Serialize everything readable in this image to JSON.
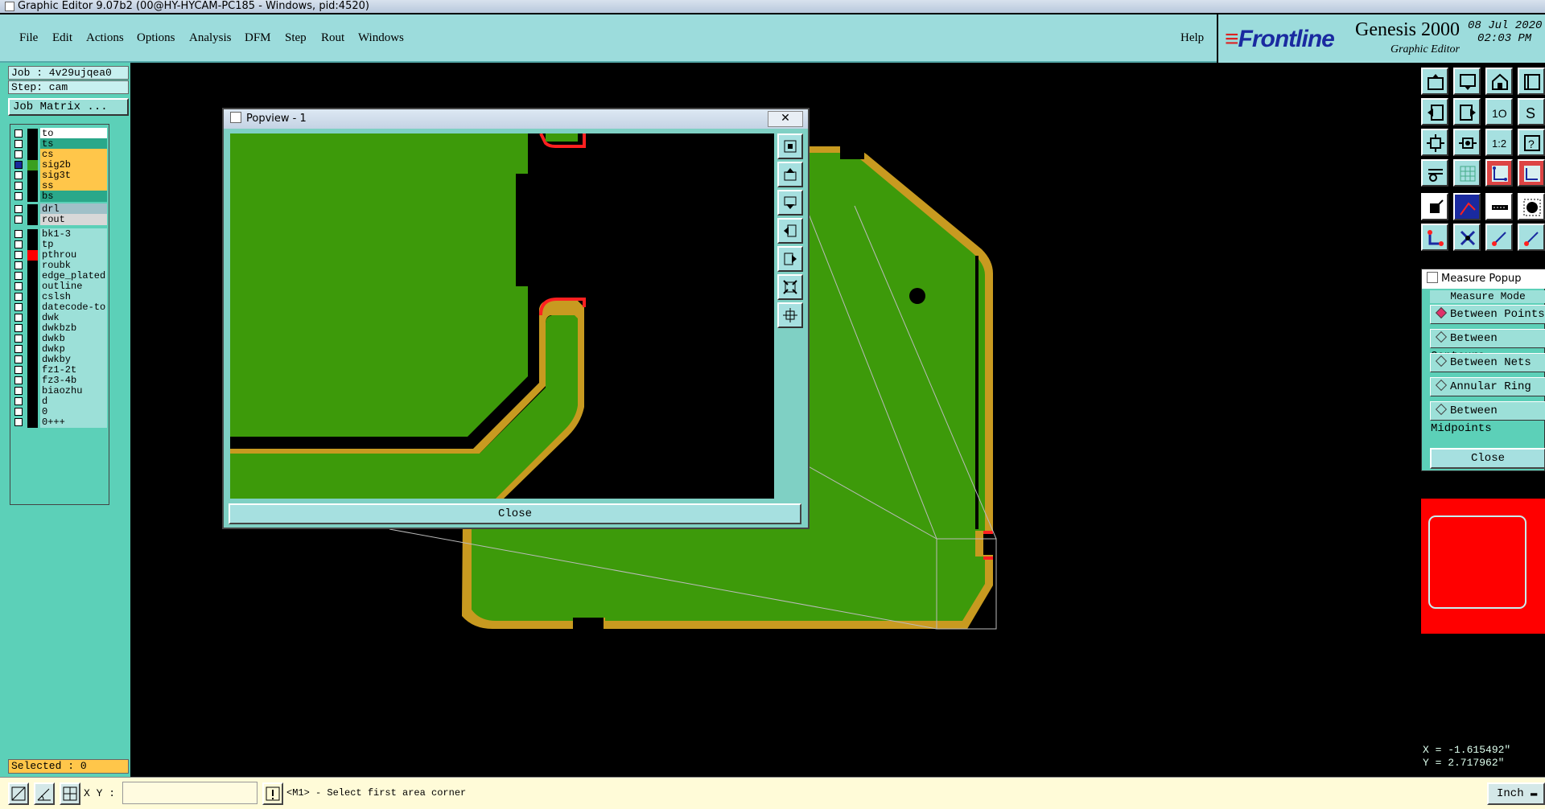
{
  "window": {
    "title": "Graphic Editor 9.07b2 (00@HY-HYCAM-PC185 - Windows, pid:4520)"
  },
  "menu": {
    "items": [
      "File",
      "Edit",
      "Actions",
      "Options",
      "Analysis",
      "DFM",
      "Step",
      "Rout",
      "Windows"
    ],
    "help": "Help"
  },
  "brand": {
    "logo": "Frontline",
    "product": "Genesis 2000",
    "subtitle": "Graphic Editor",
    "date": "08 Jul 2020",
    "time": "02:03 PM"
  },
  "job": {
    "job_label": "Job : 4v29ujqea0",
    "step_label": "Step: cam",
    "matrix_button": "Job Matrix ..."
  },
  "layers": [
    {
      "name": "to",
      "color": "#ffffff",
      "swatch": "#000000",
      "check": "#ffffff"
    },
    {
      "name": "ts",
      "color": "#2aa88a",
      "swatch": "#000000",
      "check": "#ffffff"
    },
    {
      "name": "cs",
      "color": "#ffc64a",
      "swatch": "#000000",
      "check": "#ffffff"
    },
    {
      "name": "sig2b",
      "color": "#ffc64a",
      "swatch": "#3aa021",
      "check": "#1a2a9a"
    },
    {
      "name": "sig3t",
      "color": "#ffc64a",
      "swatch": "#000000",
      "check": "#ffffff"
    },
    {
      "name": "ss",
      "color": "#ffc64a",
      "swatch": "#000000",
      "check": "#ffffff"
    },
    {
      "name": "bs",
      "color": "#2aa88a",
      "swatch": "#000000",
      "check": "#ffffff"
    },
    {
      "name": "drl",
      "color": "#a0c0c8",
      "swatch": "#000000",
      "check": "#ffffff"
    },
    {
      "name": "rout",
      "color": "#d8d8d8",
      "swatch": "#000000",
      "check": "#ffffff"
    },
    {
      "name": "bk1-3",
      "color": "#9ce0d8",
      "swatch": "#000000",
      "check": "#ffffff"
    },
    {
      "name": "tp",
      "color": "#9ce0d8",
      "swatch": "#000000",
      "check": "#ffffff"
    },
    {
      "name": "pthrou",
      "color": "#9ce0d8",
      "swatch": "#ff0000",
      "check": "#ffffff"
    },
    {
      "name": "roubk",
      "color": "#9ce0d8",
      "swatch": "#000000",
      "check": "#ffffff"
    },
    {
      "name": "edge_plated",
      "color": "#9ce0d8",
      "swatch": "#000000",
      "check": "#ffffff"
    },
    {
      "name": "outline",
      "color": "#9ce0d8",
      "swatch": "#000000",
      "check": "#ffffff"
    },
    {
      "name": "cslsh",
      "color": "#9ce0d8",
      "swatch": "#000000",
      "check": "#ffffff"
    },
    {
      "name": "datecode-to",
      "color": "#9ce0d8",
      "swatch": "#000000",
      "check": "#ffffff"
    },
    {
      "name": "dwk",
      "color": "#9ce0d8",
      "swatch": "#000000",
      "check": "#ffffff"
    },
    {
      "name": "dwkbzb",
      "color": "#9ce0d8",
      "swatch": "#000000",
      "check": "#ffffff"
    },
    {
      "name": "dwkb",
      "color": "#9ce0d8",
      "swatch": "#000000",
      "check": "#ffffff"
    },
    {
      "name": "dwkp",
      "color": "#9ce0d8",
      "swatch": "#000000",
      "check": "#ffffff"
    },
    {
      "name": "dwkby",
      "color": "#9ce0d8",
      "swatch": "#000000",
      "check": "#ffffff"
    },
    {
      "name": "fz1-2t",
      "color": "#9ce0d8",
      "swatch": "#000000",
      "check": "#ffffff"
    },
    {
      "name": "fz3-4b",
      "color": "#9ce0d8",
      "swatch": "#000000",
      "check": "#ffffff"
    },
    {
      "name": "biaozhu",
      "color": "#9ce0d8",
      "swatch": "#000000",
      "check": "#ffffff"
    },
    {
      "name": "d",
      "color": "#9ce0d8",
      "swatch": "#000000",
      "check": "#ffffff"
    },
    {
      "name": "0",
      "color": "#9ce0d8",
      "swatch": "#000000",
      "check": "#ffffff"
    },
    {
      "name": "0+++",
      "color": "#9ce0d8",
      "swatch": "#000000",
      "check": "#ffffff"
    }
  ],
  "selected": "Selected : 0",
  "popview": {
    "title": "Popview - 1",
    "close": "Close",
    "close_x": "✕"
  },
  "measure": {
    "title": "Measure Popup",
    "mode_label": "Measure Mode",
    "options": [
      "Between Points",
      "Between Contours",
      "Between Nets",
      "Annular Ring",
      "Between Midpoints"
    ],
    "selected_index": 0,
    "close": "Close"
  },
  "coords": {
    "x": "X = -1.615492\"",
    "y": "Y = 2.717962\""
  },
  "bottom": {
    "xy_label": "X Y :",
    "xy_value": "",
    "status": "<M1> - Select first area corner",
    "units": "Inch"
  },
  "colors": {
    "copper": "#3d9a0a",
    "edge": "#c89a20",
    "red": "#ff2020",
    "panel": "#5cd0b8",
    "accent": "#1a2aa0"
  }
}
